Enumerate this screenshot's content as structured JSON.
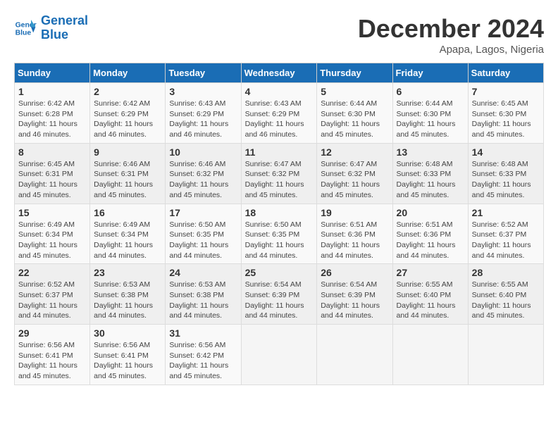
{
  "header": {
    "logo_line1": "General",
    "logo_line2": "Blue",
    "month": "December 2024",
    "location": "Apapa, Lagos, Nigeria"
  },
  "days_of_week": [
    "Sunday",
    "Monday",
    "Tuesday",
    "Wednesday",
    "Thursday",
    "Friday",
    "Saturday"
  ],
  "weeks": [
    [
      {
        "day": "1",
        "sunrise": "6:42 AM",
        "sunset": "6:28 PM",
        "daylight": "11 hours and 46 minutes."
      },
      {
        "day": "2",
        "sunrise": "6:42 AM",
        "sunset": "6:29 PM",
        "daylight": "11 hours and 46 minutes."
      },
      {
        "day": "3",
        "sunrise": "6:43 AM",
        "sunset": "6:29 PM",
        "daylight": "11 hours and 46 minutes."
      },
      {
        "day": "4",
        "sunrise": "6:43 AM",
        "sunset": "6:29 PM",
        "daylight": "11 hours and 46 minutes."
      },
      {
        "day": "5",
        "sunrise": "6:44 AM",
        "sunset": "6:30 PM",
        "daylight": "11 hours and 45 minutes."
      },
      {
        "day": "6",
        "sunrise": "6:44 AM",
        "sunset": "6:30 PM",
        "daylight": "11 hours and 45 minutes."
      },
      {
        "day": "7",
        "sunrise": "6:45 AM",
        "sunset": "6:30 PM",
        "daylight": "11 hours and 45 minutes."
      }
    ],
    [
      {
        "day": "8",
        "sunrise": "6:45 AM",
        "sunset": "6:31 PM",
        "daylight": "11 hours and 45 minutes."
      },
      {
        "day": "9",
        "sunrise": "6:46 AM",
        "sunset": "6:31 PM",
        "daylight": "11 hours and 45 minutes."
      },
      {
        "day": "10",
        "sunrise": "6:46 AM",
        "sunset": "6:32 PM",
        "daylight": "11 hours and 45 minutes."
      },
      {
        "day": "11",
        "sunrise": "6:47 AM",
        "sunset": "6:32 PM",
        "daylight": "11 hours and 45 minutes."
      },
      {
        "day": "12",
        "sunrise": "6:47 AM",
        "sunset": "6:32 PM",
        "daylight": "11 hours and 45 minutes."
      },
      {
        "day": "13",
        "sunrise": "6:48 AM",
        "sunset": "6:33 PM",
        "daylight": "11 hours and 45 minutes."
      },
      {
        "day": "14",
        "sunrise": "6:48 AM",
        "sunset": "6:33 PM",
        "daylight": "11 hours and 45 minutes."
      }
    ],
    [
      {
        "day": "15",
        "sunrise": "6:49 AM",
        "sunset": "6:34 PM",
        "daylight": "11 hours and 45 minutes."
      },
      {
        "day": "16",
        "sunrise": "6:49 AM",
        "sunset": "6:34 PM",
        "daylight": "11 hours and 44 minutes."
      },
      {
        "day": "17",
        "sunrise": "6:50 AM",
        "sunset": "6:35 PM",
        "daylight": "11 hours and 44 minutes."
      },
      {
        "day": "18",
        "sunrise": "6:50 AM",
        "sunset": "6:35 PM",
        "daylight": "11 hours and 44 minutes."
      },
      {
        "day": "19",
        "sunrise": "6:51 AM",
        "sunset": "6:36 PM",
        "daylight": "11 hours and 44 minutes."
      },
      {
        "day": "20",
        "sunrise": "6:51 AM",
        "sunset": "6:36 PM",
        "daylight": "11 hours and 44 minutes."
      },
      {
        "day": "21",
        "sunrise": "6:52 AM",
        "sunset": "6:37 PM",
        "daylight": "11 hours and 44 minutes."
      }
    ],
    [
      {
        "day": "22",
        "sunrise": "6:52 AM",
        "sunset": "6:37 PM",
        "daylight": "11 hours and 44 minutes."
      },
      {
        "day": "23",
        "sunrise": "6:53 AM",
        "sunset": "6:38 PM",
        "daylight": "11 hours and 44 minutes."
      },
      {
        "day": "24",
        "sunrise": "6:53 AM",
        "sunset": "6:38 PM",
        "daylight": "11 hours and 44 minutes."
      },
      {
        "day": "25",
        "sunrise": "6:54 AM",
        "sunset": "6:39 PM",
        "daylight": "11 hours and 44 minutes."
      },
      {
        "day": "26",
        "sunrise": "6:54 AM",
        "sunset": "6:39 PM",
        "daylight": "11 hours and 44 minutes."
      },
      {
        "day": "27",
        "sunrise": "6:55 AM",
        "sunset": "6:40 PM",
        "daylight": "11 hours and 44 minutes."
      },
      {
        "day": "28",
        "sunrise": "6:55 AM",
        "sunset": "6:40 PM",
        "daylight": "11 hours and 45 minutes."
      }
    ],
    [
      {
        "day": "29",
        "sunrise": "6:56 AM",
        "sunset": "6:41 PM",
        "daylight": "11 hours and 45 minutes."
      },
      {
        "day": "30",
        "sunrise": "6:56 AM",
        "sunset": "6:41 PM",
        "daylight": "11 hours and 45 minutes."
      },
      {
        "day": "31",
        "sunrise": "6:56 AM",
        "sunset": "6:42 PM",
        "daylight": "11 hours and 45 minutes."
      },
      null,
      null,
      null,
      null
    ]
  ],
  "labels": {
    "sunrise": "Sunrise:",
    "sunset": "Sunset:",
    "daylight": "Daylight:"
  }
}
